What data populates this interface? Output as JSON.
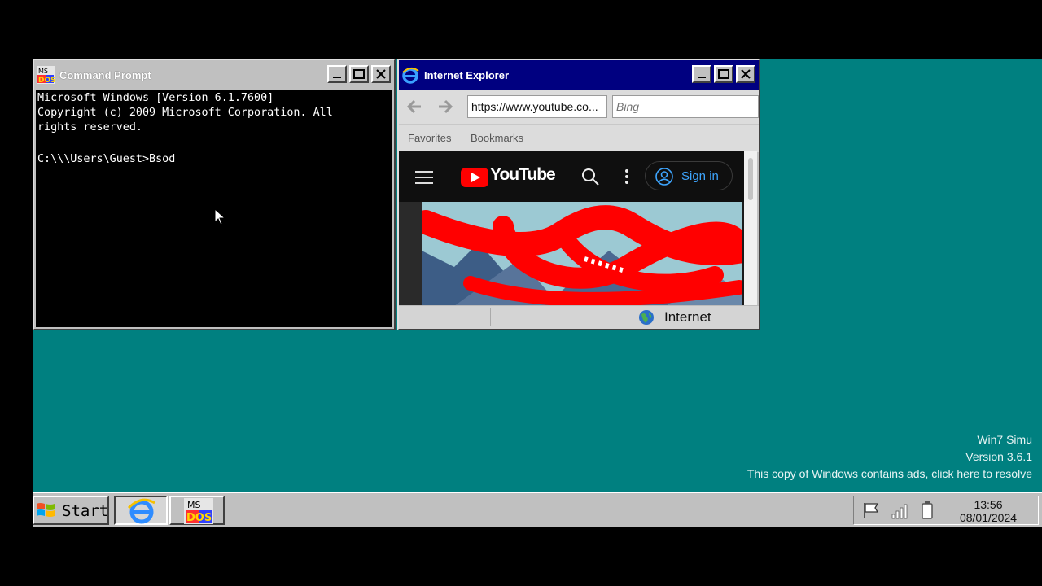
{
  "cmd": {
    "title": "Command Prompt",
    "icon": "ms-dos-icon",
    "lines": [
      "Microsoft Windows [Version 6.1.7600]",
      "Copyright (c) 2009 Microsoft Corporation. All",
      "rights reserved.",
      "",
      "C:\\\\\\Users\\Guest>Bsod"
    ]
  },
  "ie": {
    "title": "Internet Explorer",
    "address": "https://www.youtube.co...",
    "search_placeholder": "Bing",
    "favorites_label": "Favorites",
    "bookmarks_label": "Bookmarks",
    "status_zone": "Internet",
    "page": {
      "logo_text": "YouTube",
      "sign_in_label": "Sign in"
    }
  },
  "desktop": {
    "watermark": {
      "line1": "Win7 Simu",
      "line2": "Version 3.6.1",
      "line3": "This copy of Windows contains ads, click here to resolve"
    }
  },
  "taskbar": {
    "start_label": "Start",
    "time": "13:56",
    "date": "08/01/2024",
    "items": [
      {
        "name": "Internet Explorer",
        "icon": "ie-icon",
        "active": true
      },
      {
        "name": "Command Prompt",
        "icon": "ms-dos-icon",
        "active": false
      }
    ],
    "tray_icons": [
      "flag-icon",
      "signal-icon",
      "battery-icon"
    ]
  },
  "colors": {
    "desktop": "#008080",
    "ie_title": "#000080",
    "youtube_red": "#ff0000",
    "signin_blue": "#3ea6ff"
  }
}
